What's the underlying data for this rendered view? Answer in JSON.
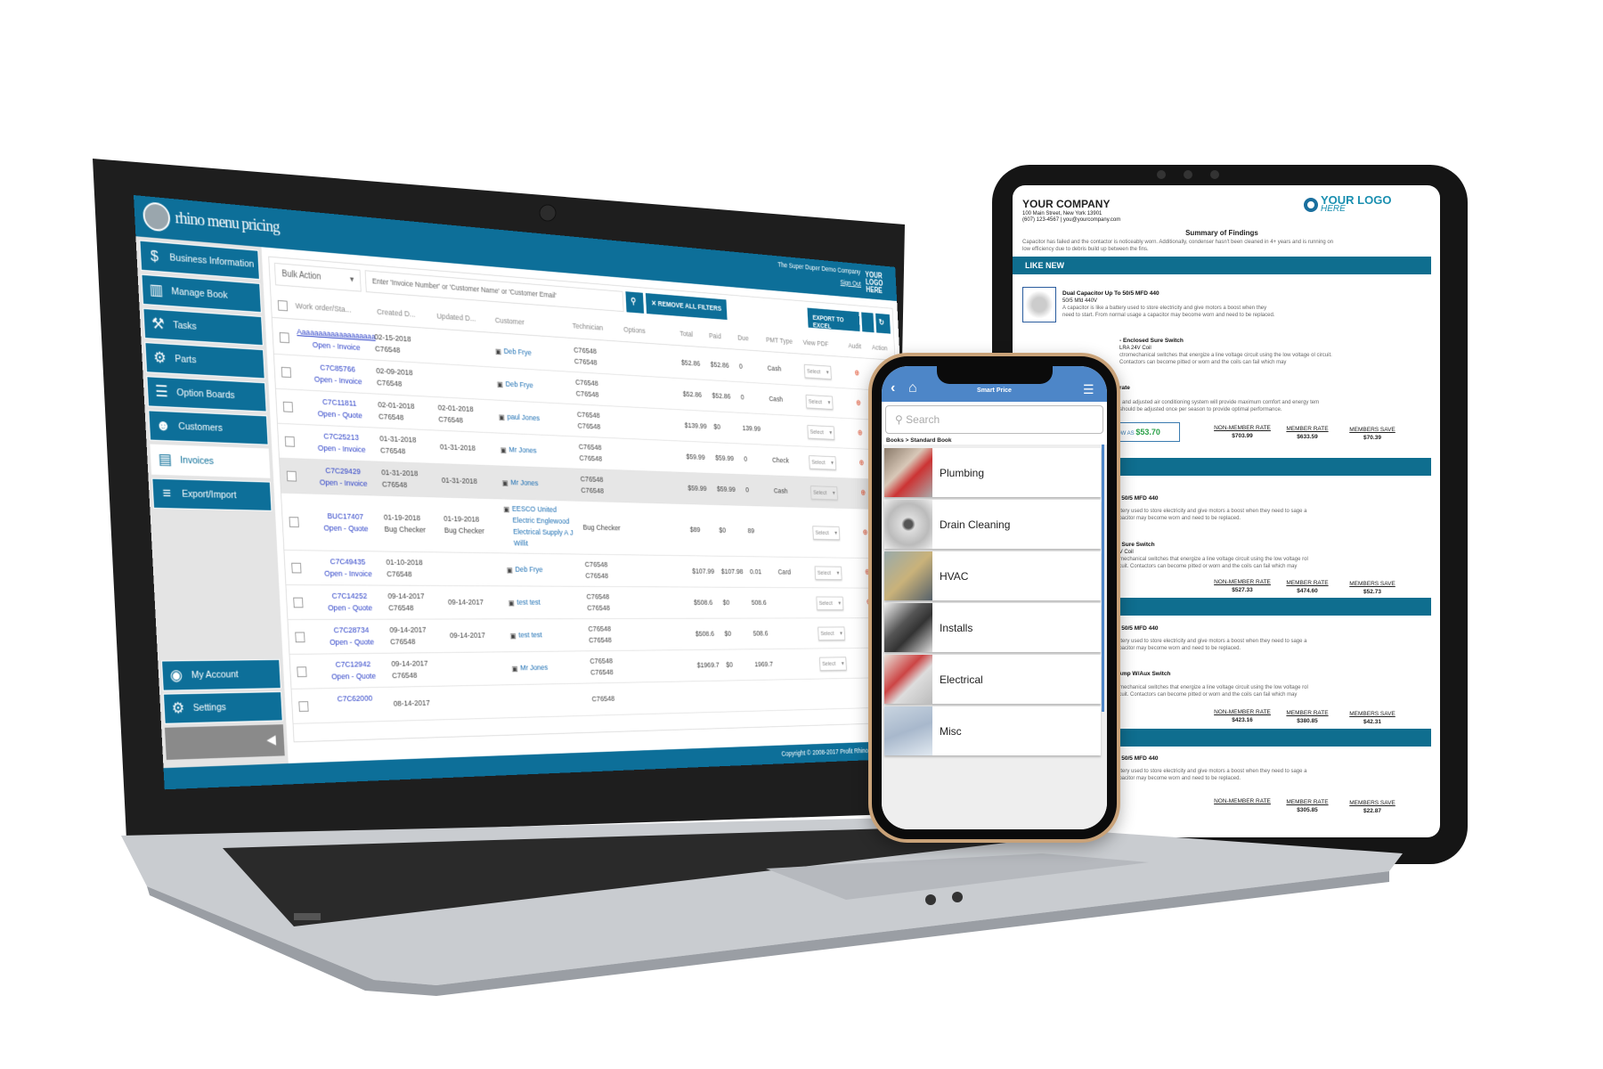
{
  "laptop": {
    "brand": "rhino menu pricing",
    "company": "The Super Duper Demo Company",
    "sign_out": "Sign Out",
    "mini_logo": "YOUR LOGO HERE",
    "sidebar": {
      "items": [
        {
          "label": "Business Information",
          "icon": "$"
        },
        {
          "label": "Manage Book",
          "icon": "▥"
        },
        {
          "label": "Tasks",
          "icon": "⚒"
        },
        {
          "label": "Parts",
          "icon": "⚙"
        },
        {
          "label": "Option Boards",
          "icon": "☰"
        },
        {
          "label": "Customers",
          "icon": "☻"
        },
        {
          "label": "Invoices",
          "icon": "▤",
          "active": true
        },
        {
          "label": "Export/Import",
          "icon": "≡"
        }
      ],
      "bottom_items": [
        {
          "label": "My Account",
          "icon": "◉"
        },
        {
          "label": "Settings",
          "icon": "⚙"
        }
      ],
      "collapse_icon": "◀"
    },
    "toolbar": {
      "bulk_action": "Bulk Action",
      "search_placeholder": "Enter  'Invoice Number' or 'Customer Name' or 'Customer Email'",
      "remove_filters": "✕ REMOVE ALL FILTERS",
      "export_excel": "EXPORT TO EXCEL"
    },
    "columns": [
      "Work order/Sta...",
      "Created D...",
      "Updated D...",
      "Customer",
      "Technician",
      "Options",
      "Total",
      "Paid",
      "Due",
      "PMT Type",
      "View PDF",
      "Audit",
      "Action"
    ],
    "rows": [
      {
        "id": "Aaaaaaaaaaaaaaaaaaa",
        "status": "Open - Invoice",
        "created": [
          "02-15-2018",
          "C76548"
        ],
        "updated": [],
        "customer": [
          "Deb Frye"
        ],
        "tech": [
          "C76548",
          "C76548"
        ],
        "total": "$52.86",
        "paid": "$52.86",
        "due": "0",
        "pmt": "Cash",
        "select": "Select"
      },
      {
        "id": "C7C85766",
        "status": "Open - Invoice",
        "created": [
          "02-09-2018",
          "C76548"
        ],
        "updated": [],
        "customer": [
          "Deb Frye"
        ],
        "tech": [
          "C76548",
          "C76548"
        ],
        "total": "$52.86",
        "paid": "$52.86",
        "due": "0",
        "pmt": "Cash",
        "select": "Select"
      },
      {
        "id": "C7C11811",
        "status": "Open - Quote",
        "created": [
          "02-01-2018",
          "C76548"
        ],
        "updated": [
          "02-01-2018",
          "C76548"
        ],
        "customer": [
          "paul Jones"
        ],
        "tech": [
          "C76548",
          "C76548"
        ],
        "total": "$139.99",
        "paid": "$0",
        "due": "139.99",
        "pmt": "",
        "select": "Select"
      },
      {
        "id": "C7C25213",
        "status": "Open - Invoice",
        "created": [
          "01-31-2018",
          "C76548"
        ],
        "updated": [
          "01-31-2018"
        ],
        "customer": [
          "Mr Jones"
        ],
        "tech": [
          "C76548",
          "C76548"
        ],
        "total": "$59.99",
        "paid": "$59.99",
        "due": "0",
        "pmt": "Check",
        "select": "Select"
      },
      {
        "id": "C7C29429",
        "status": "Open - Invoice",
        "created": [
          "01-31-2018",
          "C76548"
        ],
        "updated": [
          "01-31-2018"
        ],
        "customer": [
          "Mr Jones"
        ],
        "tech": [
          "C76548",
          "C76548"
        ],
        "total": "$59.99",
        "paid": "$59.99",
        "due": "0",
        "pmt": "Cash",
        "select": "Select",
        "highlight": true
      },
      {
        "id": "BUC17407",
        "status": "Open - Quote",
        "created": [
          "01-19-2018",
          "Bug Checker"
        ],
        "updated": [
          "01-19-2018",
          "Bug Checker"
        ],
        "customer": [
          "EESCO United",
          "Electric Englewood",
          "Electrical Supply A J",
          "Willit"
        ],
        "tech": [
          "Bug Checker"
        ],
        "total": "$89",
        "paid": "$0",
        "due": "89",
        "pmt": "",
        "select": "Select",
        "tall": true
      },
      {
        "id": "C7C49435",
        "status": "Open - Invoice",
        "created": [
          "01-10-2018",
          "C76548"
        ],
        "updated": [],
        "customer": [
          "Deb Frye"
        ],
        "tech": [
          "C76548",
          "C76548"
        ],
        "total": "$107.99",
        "paid": "$107.98",
        "due": "0.01",
        "pmt": "Card",
        "select": "Select"
      },
      {
        "id": "C7C14252",
        "status": "Open - Quote",
        "created": [
          "09-14-2017",
          "C76548"
        ],
        "updated": [
          "09-14-2017"
        ],
        "customer": [
          "test test"
        ],
        "tech": [
          "C76548",
          "C76548"
        ],
        "total": "$508.6",
        "paid": "$0",
        "due": "508.6",
        "pmt": "",
        "select": "Select"
      },
      {
        "id": "C7C28734",
        "status": "Open - Quote",
        "created": [
          "09-14-2017",
          "C76548"
        ],
        "updated": [
          "09-14-2017"
        ],
        "customer": [
          "test test"
        ],
        "tech": [
          "C76548",
          "C76548"
        ],
        "total": "$508.6",
        "paid": "$0",
        "due": "508.6",
        "pmt": "",
        "select": "Select"
      },
      {
        "id": "C7C12942",
        "status": "Open - Quote",
        "created": [
          "09-14-2017",
          "C76548"
        ],
        "updated": [],
        "customer": [
          "Mr Jones"
        ],
        "tech": [
          "C76548",
          "C76548"
        ],
        "total": "$1969.7",
        "paid": "$0",
        "due": "1969.7",
        "pmt": "",
        "select": "Select"
      },
      {
        "id": "C7C62000",
        "status": "",
        "created": [
          "08-14-2017"
        ],
        "updated": [],
        "customer": [],
        "tech": [
          "C76548"
        ],
        "total": "",
        "paid": "",
        "due": "",
        "pmt": "",
        "select": ""
      }
    ],
    "footer": "Copyright © 2008-2017 Profit Rhino. All rights reserved."
  },
  "tablet": {
    "company": "YOUR COMPANY",
    "address": "100 Main Street, New York 13901",
    "contact": "(607) 123-4567 | you@yourcompany.com",
    "logo": {
      "line1": "YOUR LOGO",
      "line2": "HERE"
    },
    "summary_title": "Summary of Findings",
    "summary_text": "Capacitor has failed and the contactor is noticeably worn. Additionally, condenser hasn't been cleaned in 4+ years and is running on low efficiency due to debris build up between the fins.",
    "section1": "LIKE NEW",
    "item1": {
      "title": "Dual Capacitor Up To 50/5 MFD 440",
      "sub": "50/5 Mfd 440V",
      "desc": "A capacitor is like a battery used to store electricity and give motors a boost when they need to start. From normal usage a capacitor may become worn and need to be replaced."
    },
    "item2": {
      "title": "- Enclosed Sure Switch",
      "sub": "LRA 24V Coil",
      "desc": "ctromechanical switches that energize a line voltage circuit using the low voltage ol circuit. Contactors can become pitted or worn and the coils can fail which may"
    },
    "item3": {
      "title": "rate",
      "desc": "l and adjusted air conditioning system will provide maximum comfort and energy tem should be adjusted once per season to provide optimal performance."
    },
    "low_as": {
      "label": "OW AS",
      "value": "$53.70"
    },
    "section2": "S",
    "frag_cap": "To 50/5 MFD 440",
    "frag_cap_desc": "battery used to store electricity and give motors a boost when they need to sage a capacitor may become worn and need to be replaced.",
    "frag_switch": "ed Sure Switch",
    "frag_switch_sub": "24V Coil",
    "frag_switch_desc": "tromechanical switches that energize a line voltage circuit using the low voltage rol circuit. Contactors can become pitted or worn and the coils can fail which may",
    "frag_aux": "0 Amp W/Aux Switch",
    "price_labels": {
      "non_member": "NON-MEMBER RATE",
      "member": "MEMBER RATE",
      "save": "MEMBERS SAVE"
    },
    "prices": [
      {
        "non_member": "$703.99",
        "member": "$633.59",
        "save": "$70.39"
      },
      {
        "non_member": "$527.33",
        "member": "$474.60",
        "save": "$52.73"
      },
      {
        "non_member": "$423.16",
        "member": "$380.85",
        "save": "$42.31"
      },
      {
        "non_member": "",
        "member": "$305.85",
        "save": "$22.87"
      }
    ],
    "accent": "#0f6e8f"
  },
  "phone": {
    "title": "Smart Price",
    "search_placeholder": "Search",
    "breadcrumb": "Books > Standard Book",
    "items": [
      "Plumbing",
      "Drain Cleaning",
      "HVAC",
      "Installs",
      "Electrical",
      "Misc"
    ],
    "header_color": "#4d86c8"
  }
}
